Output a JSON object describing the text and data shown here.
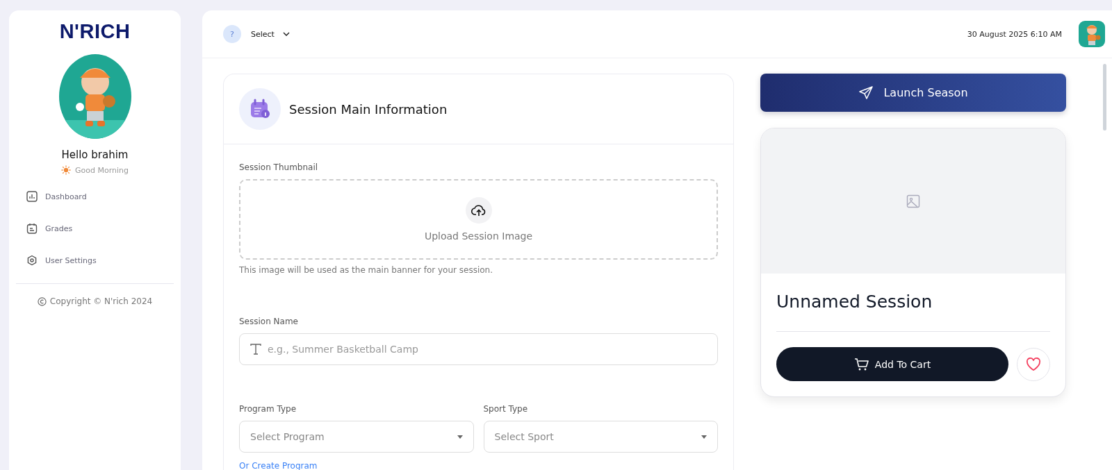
{
  "sidebar": {
    "logo": "N'RICH",
    "greeting": "Hello brahim",
    "subgreeting": "Good Morning",
    "items": [
      {
        "label": "Dashboard"
      },
      {
        "label": "Grades"
      },
      {
        "label": "User Settings"
      }
    ],
    "copyright": "Copyright © N'rich 2024"
  },
  "header": {
    "help": "?",
    "select": "Select",
    "datetime": "30 August 2025 6:10 AM"
  },
  "form": {
    "title": "Session Main Information",
    "thumbnail": {
      "label": "Session Thumbnail",
      "upload": "Upload Session Image",
      "hint": "This image will be used as the main banner for your session."
    },
    "name": {
      "label": "Session Name",
      "placeholder": "e.g., Summer Basketball Camp"
    },
    "selects": [
      {
        "label": "Program Type",
        "placeholder": "Select Program"
      },
      {
        "label": "Sport Type",
        "placeholder": "Select Sport"
      }
    ],
    "link": "Or Create Program"
  },
  "launch": "Launch Season",
  "preview": {
    "title": "Unnamed Session",
    "cart": "Add To Cart",
    "favorite": false
  }
}
